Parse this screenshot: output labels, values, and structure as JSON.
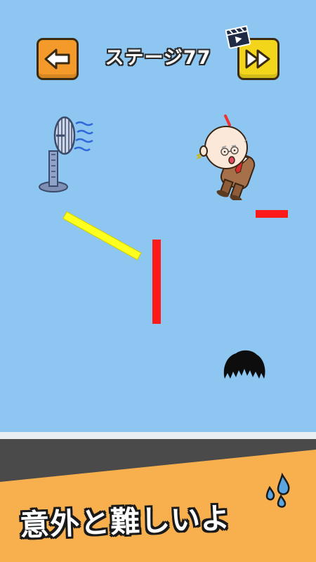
{
  "header": {
    "stage_title": "ステージ77",
    "back_icon": "arrow-left-icon",
    "skip_icon": "fast-forward-icon",
    "ad_icon": "clapperboard-icon"
  },
  "caption": {
    "text": "意外と難しいよ"
  },
  "colors": {
    "sky": "#8ec6f2",
    "back_button": "#f49a2a",
    "skip_button": "#f3d51c",
    "barrier": "#ff1a1a",
    "drawn_line": "#ffff1f",
    "banner": "#f8b04e",
    "ground": "#4a4a4a"
  }
}
